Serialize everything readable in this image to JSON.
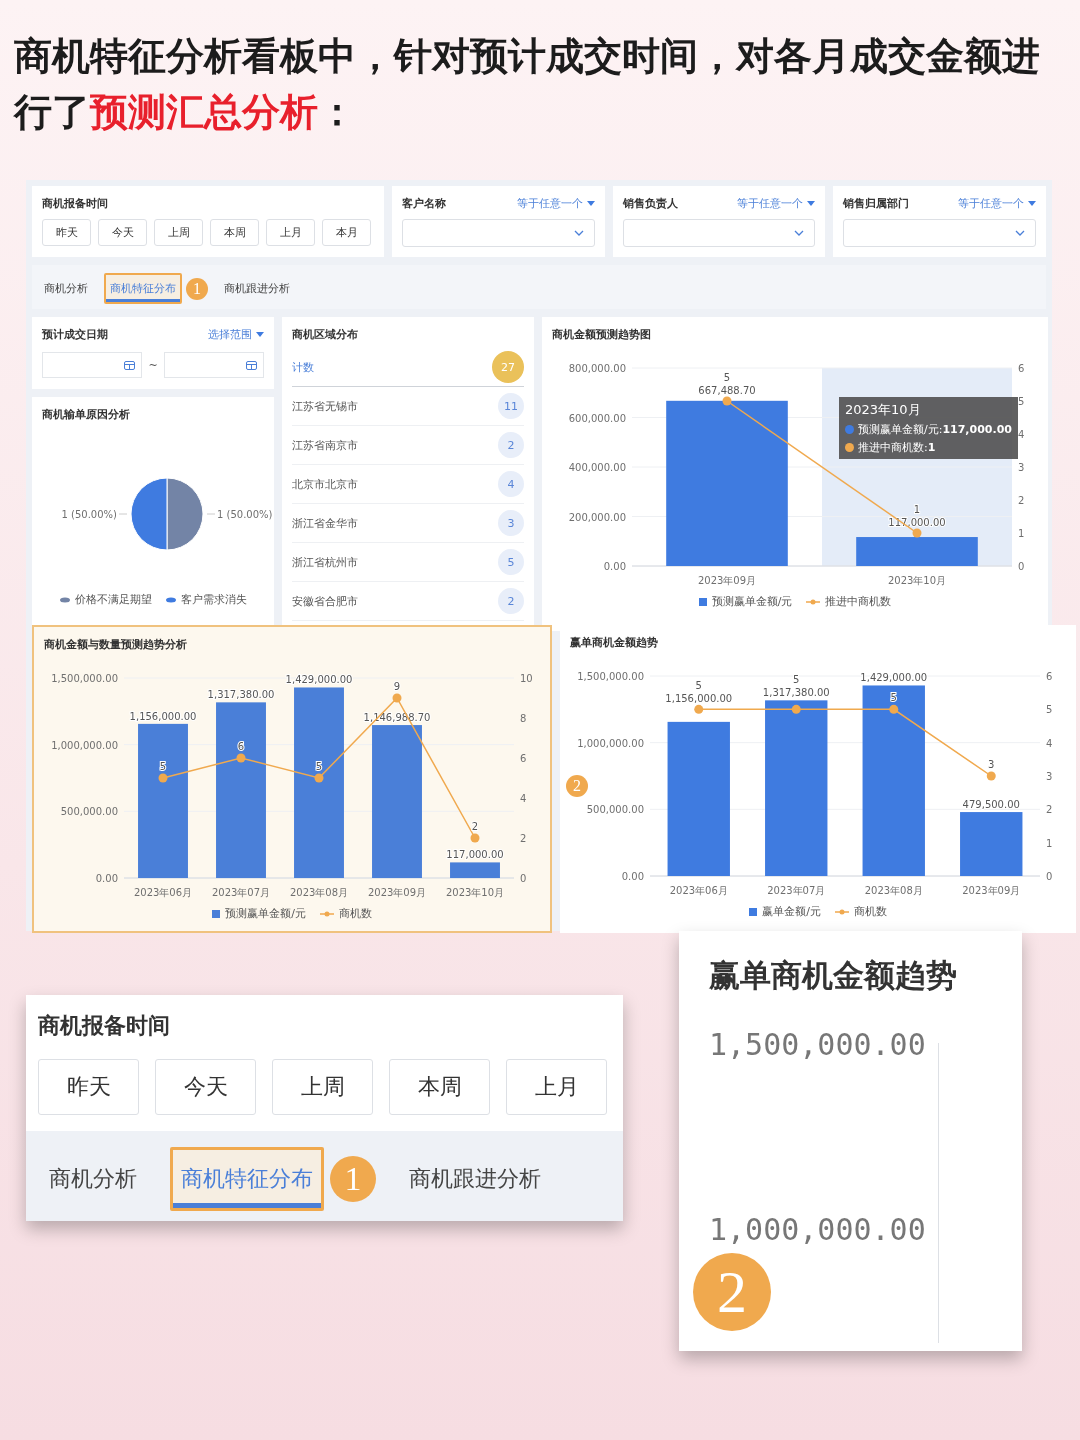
{
  "headline": [
    {
      "text": "商机特征分析看板中，针对预计成交时间，对各月成交金额进行了",
      "highlight": false
    },
    {
      "text": "预测汇总分析",
      "highlight": true
    },
    {
      "text": "：",
      "highlight": false
    }
  ],
  "dashboard": {
    "report_time": {
      "label": "商机报备时间",
      "buttons": [
        "昨天",
        "今天",
        "上周",
        "本周",
        "上月",
        "本月"
      ]
    },
    "select_filters": [
      {
        "label": "客户名称",
        "operator": "等于任意一个"
      },
      {
        "label": "销售负责人",
        "operator": "等于任意一个"
      },
      {
        "label": "销售归属部门",
        "operator": "等于任意一个"
      }
    ],
    "tabs": [
      {
        "label": "商机分析",
        "selected": false,
        "annotated": false
      },
      {
        "label": "商机特征分布",
        "selected": true,
        "annotated": true,
        "callout": "1"
      },
      {
        "label": "商机跟进分析",
        "selected": false,
        "annotated": false
      }
    ],
    "expected_date": {
      "title": "预计成交日期",
      "range_button": "选择范围",
      "separator": "~"
    },
    "loss_reasons": {
      "title": "商机输单原因分析",
      "chart_data": {
        "type": "pie",
        "categories": [
          "价格不满足期望",
          "客户需求消失"
        ],
        "values": [
          1,
          1
        ],
        "colors": [
          "#7384a6",
          "#3f7be0"
        ],
        "value_labels": [
          "1 (50.00%)",
          "1 (50.00%)"
        ]
      }
    },
    "regions": {
      "title": "商机区域分布",
      "total": {
        "label": "计数",
        "count": "27"
      },
      "rows": [
        {
          "name": "江苏省无锡市",
          "count": "11"
        },
        {
          "name": "江苏省南京市",
          "count": "2"
        },
        {
          "name": "北京市北京市",
          "count": "4"
        },
        {
          "name": "浙江省金华市",
          "count": "3"
        },
        {
          "name": "浙江省杭州市",
          "count": "5"
        },
        {
          "name": "安徽省合肥市",
          "count": "2"
        }
      ]
    },
    "forecast_trend": {
      "title": "商机金额预测趋势图",
      "hovered_columns": [
        false,
        true
      ],
      "amount_chart": {
        "chart_data": {
          "type": "bar",
          "categories": [
            "2023年09月",
            "2023年10月"
          ],
          "grid": true,
          "series": [
            {
              "name": "预测赢单金额/元",
              "color": "#3f7be0",
              "values": [
                667488.7,
                117000
              ],
              "value_labels": [
                "667,488.70",
                "117,000.00"
              ]
            }
          ],
          "ylim": [
            0,
            800000
          ],
          "yticks": [
            {
              "value": 0,
              "label": "0.00"
            },
            {
              "value": 200000,
              "label": "200,000.00"
            },
            {
              "value": 400000,
              "label": "400,000.00"
            },
            {
              "value": 600000,
              "label": "600,000.00"
            },
            {
              "value": 800000,
              "label": "800,000.00"
            }
          ]
        }
      },
      "count_chart": {
        "chart_data": {
          "type": "line",
          "series": [
            {
              "name": "推进中商机数",
              "color": "#f0a94e",
              "marker": true,
              "values": [
                5,
                1
              ],
              "value_labels": [
                "5",
                "1"
              ]
            }
          ],
          "ylim": [
            0,
            6
          ],
          "yticks": [
            0,
            1,
            2,
            3,
            4,
            5,
            6
          ]
        }
      },
      "tooltip": {
        "title": "2023年10月",
        "rows": [
          {
            "text": "预测赢单金额/元:**117,000.00**",
            "color": "#3f7be0"
          },
          {
            "text": "推进中商机数:**1**",
            "color": "#f0a94e"
          }
        ]
      }
    },
    "amount_count_trend": {
      "title": "商机金额与数量预测趋势分析",
      "annotated": true,
      "amount_chart": {
        "chart_data": {
          "type": "bar",
          "categories": [
            "2023年06月",
            "2023年07月",
            "2023年08月",
            "2023年09月",
            "2023年10月"
          ],
          "grid": true,
          "series": [
            {
              "name": "预测赢单金额/元",
              "color": "#4a7fd8",
              "values": [
                1156000,
                1317380,
                1429000,
                1146988.7,
                117000
              ],
              "value_labels": [
                "1,156,000.00",
                "1,317,380.00",
                "1,429,000.00",
                "1,146,988.70",
                "117,000.00"
              ]
            }
          ],
          "ylim": [
            0,
            1500000
          ],
          "yticks": [
            {
              "value": 0,
              "label": "0.00"
            },
            {
              "value": 500000,
              "label": "500,000.00"
            },
            {
              "value": 1000000,
              "label": "1,000,000.00"
            },
            {
              "value": 1500000,
              "label": "1,500,000.00"
            }
          ]
        }
      },
      "count_chart": {
        "chart_data": {
          "type": "line",
          "series": [
            {
              "name": "商机数",
              "color": "#f0a94e",
              "marker": true,
              "values": [
                5,
                6,
                5,
                9,
                2
              ],
              "value_labels": [
                "5",
                "6",
                "5",
                "9",
                "2"
              ]
            }
          ],
          "ylim": [
            0,
            10
          ],
          "yticks": [
            0,
            2,
            4,
            6,
            8,
            10
          ]
        }
      }
    },
    "win_trend": {
      "title": "赢单商机金额趋势",
      "callout": "2",
      "amount_chart": {
        "chart_data": {
          "type": "bar",
          "categories": [
            "2023年06月",
            "2023年07月",
            "2023年08月",
            "2023年09月"
          ],
          "grid": true,
          "series": [
            {
              "name": "赢单金额/元",
              "color": "#3f7be0",
              "values": [
                1156000,
                1317380,
                1429000,
                479500
              ],
              "value_labels": [
                "1,156,000.00",
                "1,317,380.00",
                "1,429,000.00",
                "479,500.00"
              ]
            }
          ],
          "ylim": [
            0,
            1500000
          ],
          "yticks": [
            {
              "value": 0,
              "label": "0.00"
            },
            {
              "value": 500000,
              "label": "500,000.00"
            },
            {
              "value": 1000000,
              "label": "1,000,000.00"
            },
            {
              "value": 1500000,
              "label": "1,500,000.00"
            }
          ]
        }
      },
      "count_chart": {
        "chart_data": {
          "type": "line",
          "series": [
            {
              "name": "商机数",
              "color": "#f0a94e",
              "marker": true,
              "values": [
                5,
                5,
                5,
                3
              ],
              "value_labels": [
                "5",
                "5",
                "5",
                "3"
              ]
            }
          ],
          "ylim": [
            0,
            6
          ],
          "yticks": [
            0,
            1,
            2,
            3,
            4,
            5,
            6
          ]
        }
      }
    }
  },
  "zoom_insets": {
    "filter": {
      "label": "商机报备时间",
      "buttons": [
        "昨天",
        "今天",
        "上周",
        "本周",
        "上月"
      ],
      "tabs": [
        {
          "label": "商机分析",
          "selected": false,
          "annotated": false
        },
        {
          "label": "商机特征分布",
          "selected": true,
          "annotated": true,
          "callout": "1"
        },
        {
          "label": "商机跟进分析",
          "selected": false,
          "annotated": false
        }
      ]
    },
    "chart": {
      "title": "赢单商机金额趋势",
      "yticks": [
        "1,500,000.00",
        "1,000,000.00"
      ],
      "callout": "2"
    }
  }
}
